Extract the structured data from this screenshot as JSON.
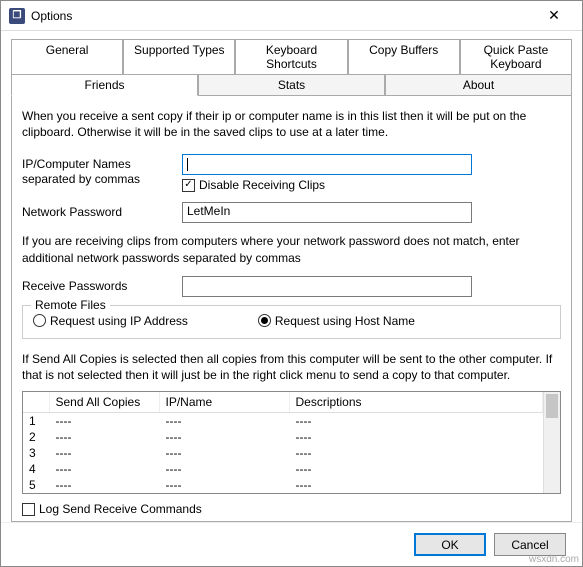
{
  "window": {
    "title": "Options",
    "close": "✕"
  },
  "tabs": {
    "row1": [
      "General",
      "Supported Types",
      "Keyboard Shortcuts",
      "Copy Buffers",
      "Quick Paste Keyboard"
    ],
    "row2": [
      "Friends",
      "Stats",
      "About"
    ],
    "active": "Friends"
  },
  "friends": {
    "intro": "When you receive a sent copy if their ip or computer name is in this list then it will be put on the clipboard. Otherwise it will be in the saved clips to use at a later time.",
    "ip_label": "IP/Computer Names separated by commas",
    "ip_value": "",
    "disable_recv_label": "Disable Receiving Clips",
    "disable_recv_checked": true,
    "net_pw_label": "Network Password",
    "net_pw_value": "LetMeIn",
    "pw_help": "If you are receiving clips from computers where your network password does not match, enter additional network passwords separated by commas",
    "recv_pw_label": "Receive Passwords",
    "recv_pw_value": "",
    "remote_files": {
      "legend": "Remote Files",
      "opt_ip": "Request using IP Address",
      "opt_host": "Request using Host Name",
      "selected": "host"
    },
    "send_desc": "If Send All Copies is selected then all copies from this computer will be sent to the other computer.  If that is not selected then it will just be in the right click menu to send a copy to that computer.",
    "grid": {
      "headers": {
        "num": "",
        "sac": "Send All Copies",
        "ip": "IP/Name",
        "desc": "Descriptions"
      },
      "rows": [
        {
          "n": "1",
          "sac": "----",
          "ip": "----",
          "desc": "----"
        },
        {
          "n": "2",
          "sac": "----",
          "ip": "----",
          "desc": "----"
        },
        {
          "n": "3",
          "sac": "----",
          "ip": "----",
          "desc": "----"
        },
        {
          "n": "4",
          "sac": "----",
          "ip": "----",
          "desc": "----"
        },
        {
          "n": "5",
          "sac": "----",
          "ip": "----",
          "desc": "----"
        }
      ]
    },
    "log_label": "Log Send Receive Commands",
    "log_checked": false
  },
  "footer": {
    "ok": "OK",
    "cancel": "Cancel"
  },
  "watermark": "wsxdn.com"
}
